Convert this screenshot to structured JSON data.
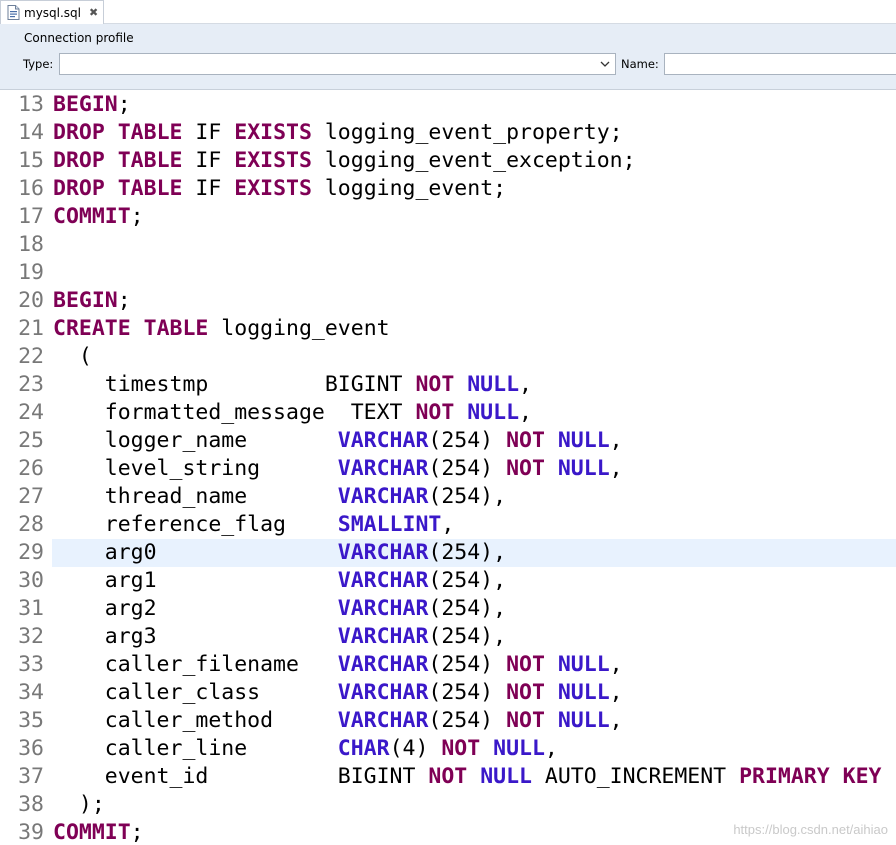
{
  "tab": {
    "title": "mysql.sql",
    "close": "✖"
  },
  "profile": {
    "title": "Connection profile",
    "type_label": "Type:",
    "type_value": "",
    "name_label": "Name:",
    "name_value": ""
  },
  "editor": {
    "highlighted_line": "29",
    "lines": [
      {
        "n": "13",
        "tokens": [
          [
            "kw",
            "BEGIN"
          ],
          [
            "t",
            ";"
          ]
        ]
      },
      {
        "n": "14",
        "tokens": [
          [
            "kw",
            "DROP"
          ],
          [
            "t",
            " "
          ],
          [
            "kw",
            "TABLE"
          ],
          [
            "t",
            " IF "
          ],
          [
            "kw",
            "EXISTS"
          ],
          [
            "t",
            " logging_event_property;"
          ]
        ]
      },
      {
        "n": "15",
        "tokens": [
          [
            "kw",
            "DROP"
          ],
          [
            "t",
            " "
          ],
          [
            "kw",
            "TABLE"
          ],
          [
            "t",
            " IF "
          ],
          [
            "kw",
            "EXISTS"
          ],
          [
            "t",
            " logging_event_exception;"
          ]
        ]
      },
      {
        "n": "16",
        "tokens": [
          [
            "kw",
            "DROP"
          ],
          [
            "t",
            " "
          ],
          [
            "kw",
            "TABLE"
          ],
          [
            "t",
            " IF "
          ],
          [
            "kw",
            "EXISTS"
          ],
          [
            "t",
            " logging_event;"
          ]
        ]
      },
      {
        "n": "17",
        "tokens": [
          [
            "kw",
            "COMMIT"
          ],
          [
            "t",
            ";"
          ]
        ]
      },
      {
        "n": "18",
        "tokens": []
      },
      {
        "n": "19",
        "tokens": []
      },
      {
        "n": "20",
        "tokens": [
          [
            "kw",
            "BEGIN"
          ],
          [
            "t",
            ";"
          ]
        ]
      },
      {
        "n": "21",
        "tokens": [
          [
            "kw",
            "CREATE"
          ],
          [
            "t",
            " "
          ],
          [
            "kw",
            "TABLE"
          ],
          [
            "t",
            " logging_event"
          ]
        ]
      },
      {
        "n": "22",
        "tokens": [
          [
            "t",
            "  ("
          ]
        ]
      },
      {
        "n": "23",
        "tokens": [
          [
            "t",
            "    timestmp         BIGINT "
          ],
          [
            "kw",
            "NOT"
          ],
          [
            "t",
            " "
          ],
          [
            "ty",
            "NULL"
          ],
          [
            "t",
            ","
          ]
        ]
      },
      {
        "n": "24",
        "tokens": [
          [
            "t",
            "    formatted_message  TEXT "
          ],
          [
            "kw",
            "NOT"
          ],
          [
            "t",
            " "
          ],
          [
            "ty",
            "NULL"
          ],
          [
            "t",
            ","
          ]
        ]
      },
      {
        "n": "25",
        "tokens": [
          [
            "t",
            "    logger_name       "
          ],
          [
            "ty",
            "VARCHAR"
          ],
          [
            "t",
            "(254) "
          ],
          [
            "kw",
            "NOT"
          ],
          [
            "t",
            " "
          ],
          [
            "ty",
            "NULL"
          ],
          [
            "t",
            ","
          ]
        ]
      },
      {
        "n": "26",
        "tokens": [
          [
            "t",
            "    level_string      "
          ],
          [
            "ty",
            "VARCHAR"
          ],
          [
            "t",
            "(254) "
          ],
          [
            "kw",
            "NOT"
          ],
          [
            "t",
            " "
          ],
          [
            "ty",
            "NULL"
          ],
          [
            "t",
            ","
          ]
        ]
      },
      {
        "n": "27",
        "tokens": [
          [
            "t",
            "    thread_name       "
          ],
          [
            "ty",
            "VARCHAR"
          ],
          [
            "t",
            "(254),"
          ]
        ]
      },
      {
        "n": "28",
        "tokens": [
          [
            "t",
            "    reference_flag    "
          ],
          [
            "ty",
            "SMALLINT"
          ],
          [
            "t",
            ","
          ]
        ]
      },
      {
        "n": "29",
        "tokens": [
          [
            "t",
            "    arg0              "
          ],
          [
            "ty",
            "VARCHAR"
          ],
          [
            "t",
            "(254),"
          ]
        ]
      },
      {
        "n": "30",
        "tokens": [
          [
            "t",
            "    arg1              "
          ],
          [
            "ty",
            "VARCHAR"
          ],
          [
            "t",
            "(254),"
          ]
        ]
      },
      {
        "n": "31",
        "tokens": [
          [
            "t",
            "    arg2              "
          ],
          [
            "ty",
            "VARCHAR"
          ],
          [
            "t",
            "(254),"
          ]
        ]
      },
      {
        "n": "32",
        "tokens": [
          [
            "t",
            "    arg3              "
          ],
          [
            "ty",
            "VARCHAR"
          ],
          [
            "t",
            "(254),"
          ]
        ]
      },
      {
        "n": "33",
        "tokens": [
          [
            "t",
            "    caller_filename   "
          ],
          [
            "ty",
            "VARCHAR"
          ],
          [
            "t",
            "(254) "
          ],
          [
            "kw",
            "NOT"
          ],
          [
            "t",
            " "
          ],
          [
            "ty",
            "NULL"
          ],
          [
            "t",
            ","
          ]
        ]
      },
      {
        "n": "34",
        "tokens": [
          [
            "t",
            "    caller_class      "
          ],
          [
            "ty",
            "VARCHAR"
          ],
          [
            "t",
            "(254) "
          ],
          [
            "kw",
            "NOT"
          ],
          [
            "t",
            " "
          ],
          [
            "ty",
            "NULL"
          ],
          [
            "t",
            ","
          ]
        ]
      },
      {
        "n": "35",
        "tokens": [
          [
            "t",
            "    caller_method     "
          ],
          [
            "ty",
            "VARCHAR"
          ],
          [
            "t",
            "(254) "
          ],
          [
            "kw",
            "NOT"
          ],
          [
            "t",
            " "
          ],
          [
            "ty",
            "NULL"
          ],
          [
            "t",
            ","
          ]
        ]
      },
      {
        "n": "36",
        "tokens": [
          [
            "t",
            "    caller_line       "
          ],
          [
            "ty",
            "CHAR"
          ],
          [
            "t",
            "(4) "
          ],
          [
            "kw",
            "NOT"
          ],
          [
            "t",
            " "
          ],
          [
            "ty",
            "NULL"
          ],
          [
            "t",
            ","
          ]
        ]
      },
      {
        "n": "37",
        "tokens": [
          [
            "t",
            "    event_id          BIGINT "
          ],
          [
            "kw",
            "NOT"
          ],
          [
            "t",
            " "
          ],
          [
            "ty",
            "NULL"
          ],
          [
            "t",
            " AUTO_INCREMENT "
          ],
          [
            "kw",
            "PRIMARY"
          ],
          [
            "t",
            " "
          ],
          [
            "kw",
            "KEY"
          ]
        ]
      },
      {
        "n": "38",
        "tokens": [
          [
            "t",
            "  );"
          ]
        ]
      },
      {
        "n": "39",
        "tokens": [
          [
            "kw",
            "COMMIT"
          ],
          [
            "t",
            ";"
          ]
        ]
      }
    ]
  },
  "watermark": "https://blog.csdn.net/aihiao",
  "colors": {
    "keyword": "#7f0055",
    "type": "#3a18c9",
    "current_line": "#e8f2fe",
    "line_number": "#787878"
  }
}
